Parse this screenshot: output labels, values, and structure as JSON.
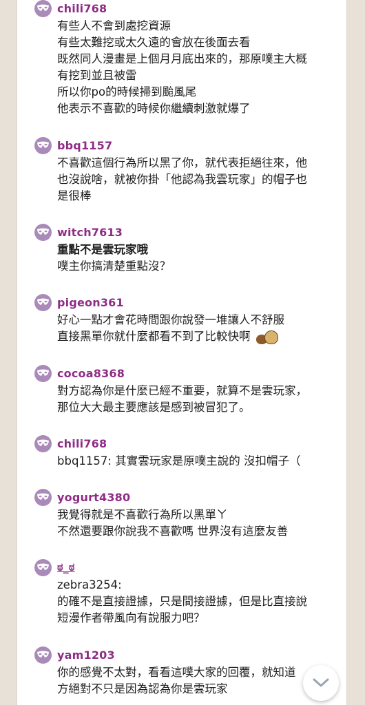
{
  "comments": [
    {
      "user": "chili768",
      "lines": [
        "有些人不會到處挖資源",
        "有些太難挖或太久遠的會放在後面去看",
        "既然同人漫畫是上個月月底出來的，那原噗主大概",
        "有挖到並且被雷",
        "所以你po的時候掃到颱風尾",
        "他表示不喜歡的時候你繼續刺激就爆了"
      ]
    },
    {
      "user": "bbq1157",
      "lines": [
        "不喜歡這個行為所以黑了你，就代表拒絕往來，他",
        "也沒說啥，就被你掛「他認為我雲玩家」的帽子也",
        "是很棒"
      ]
    },
    {
      "user": "witch7613",
      "bold_line": "重點不是雲玩家哦",
      "lines": [
        "噗主你搞清楚重點沒？"
      ]
    },
    {
      "user": "pigeon361",
      "lines": [
        "好心一點才會花時間跟你說發一堆讓人不舒服",
        "直接黑單你就什麼都看不到了比較快啊"
      ],
      "sticker_icon": "coffee-sticker"
    },
    {
      "user": "cocoa8368",
      "lines": [
        "對方認為你是什麼已經不重要，就算不是雲玩家，",
        "那位大大最主要應該是感到被冒犯了。"
      ]
    },
    {
      "user": "chili768",
      "lines": [
        "bbq1157: 其實雲玩家是原噗主說的 沒扣帽子（"
      ]
    },
    {
      "user": "yogurt4380",
      "lines": [
        "我覺得就是不喜歡行為所以黑單ㄚ",
        "不然還要跟你說我不喜歡嗎 世界沒有這麼友善"
      ]
    },
    {
      "user": "ಠ_ಠ",
      "lines": [
        "zebra3254:",
        "的確不是直接證據，只是間接證據，但是比直接說",
        "短漫作者帶風向有說服力吧？"
      ]
    },
    {
      "user": "yam1203",
      "lines": [
        "你的感覺不太對，看看這噗大家的回覆，就知道",
        "方絕對不只是因為認為你是雲玩家"
      ]
    }
  ],
  "icons": {
    "avatar": "mask-icon",
    "scroll": "chevron-down-icon"
  },
  "colors": {
    "username": "#8f2c86",
    "avatar": "#a98ab8",
    "background": "#e7e1d8"
  }
}
